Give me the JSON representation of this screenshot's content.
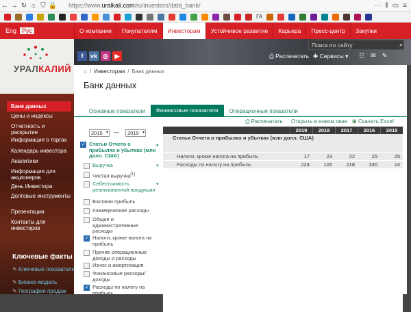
{
  "browser": {
    "url_prefix": "https://www.",
    "url_domain": "uralkali.com",
    "url_path": "/ru/investors/data_bank/",
    "bookmarks": [
      "ГА"
    ]
  },
  "topnav": {
    "lang_en": "Eng",
    "lang_ru": "Рус",
    "items": [
      "О компании",
      "Покупателям",
      "Инвесторам",
      "Устойчивое развитие",
      "Карьера",
      "Пресс-центр",
      "Закупки"
    ]
  },
  "header": {
    "search_placeholder": "Поиск по сайту",
    "print": "Распечатать",
    "services": "Сервисы"
  },
  "logo": {
    "prefix": "УРАЛ",
    "suffix": "КАЛИЙ"
  },
  "sidebar": {
    "items": [
      "Банк данных",
      "Цены и индексы",
      "Отчетность и раскрытие",
      "Информация о торгах",
      "Календарь инвестора",
      "Аналитики",
      "Информация для акционеров",
      "День Инвестора",
      "Долговые инструменты",
      "Презентации",
      "Контакты для инвесторов"
    ],
    "facts_title": "Ключевые факты",
    "facts_links": [
      "Ключевые показатели",
      "Бизнес-модель",
      "География продаж"
    ]
  },
  "breadcrumb": {
    "sep": "/",
    "investors": "Инвесторам",
    "current": "Банк данных"
  },
  "page_title": "Банк данных",
  "tabs": [
    "Основные показатели",
    "Финансовые показатели",
    "Операционные показатели"
  ],
  "actions": {
    "print": "Распечатать",
    "open_new": "Открыть в новом окне",
    "download": "Скачать Excel"
  },
  "filters": {
    "year_from": "2015",
    "year_to": "2019",
    "dash": "—",
    "items": [
      {
        "label": "Статьи Отчета о прибылях и убытках (млн долл. США)",
        "checked": true,
        "teal": true
      },
      {
        "label": "Выручка",
        "checked": false,
        "teal": true
      },
      {
        "label": "Чистая выручка",
        "note": "[1]",
        "checked": false,
        "teal": false
      },
      {
        "label": "Себестоимость реализованной продукции",
        "checked": false,
        "teal": true
      },
      {
        "label": "Валовая прибыль",
        "checked": false,
        "teal": false
      },
      {
        "label": "Коммерческие расходы",
        "checked": false,
        "teal": false
      },
      {
        "label": "Общие и административные расходы",
        "checked": false,
        "teal": false
      },
      {
        "label": "Налоги, кроме налога на прибыль",
        "checked": true,
        "teal": false
      },
      {
        "label": "Прочие операционные доходы и расходы",
        "checked": false,
        "teal": false
      },
      {
        "label": "Износ и амортизация",
        "checked": false,
        "teal": false
      },
      {
        "label": "Финансовые расходы/доходы",
        "checked": false,
        "teal": false
      },
      {
        "label": "Расходы по налогу на прибыль",
        "checked": true,
        "teal": false
      }
    ]
  },
  "table": {
    "years": [
      "2019",
      "2018",
      "2017",
      "2016",
      "2015"
    ],
    "section": "Статьи Отчета о прибылях и убытках (млн долл. США)",
    "rows": [
      {
        "name": "Налоги, кроме налога на прибыль",
        "values": [
          "17",
          "23",
          "22",
          "25",
          "25"
        ]
      },
      {
        "name": "Расходы по налогу на прибыль",
        "values": [
          "224",
          "105",
          "218",
          "330",
          "24"
        ]
      }
    ]
  },
  "colors": {
    "brand_red": "#d71f26",
    "teal": "#007a5e"
  }
}
